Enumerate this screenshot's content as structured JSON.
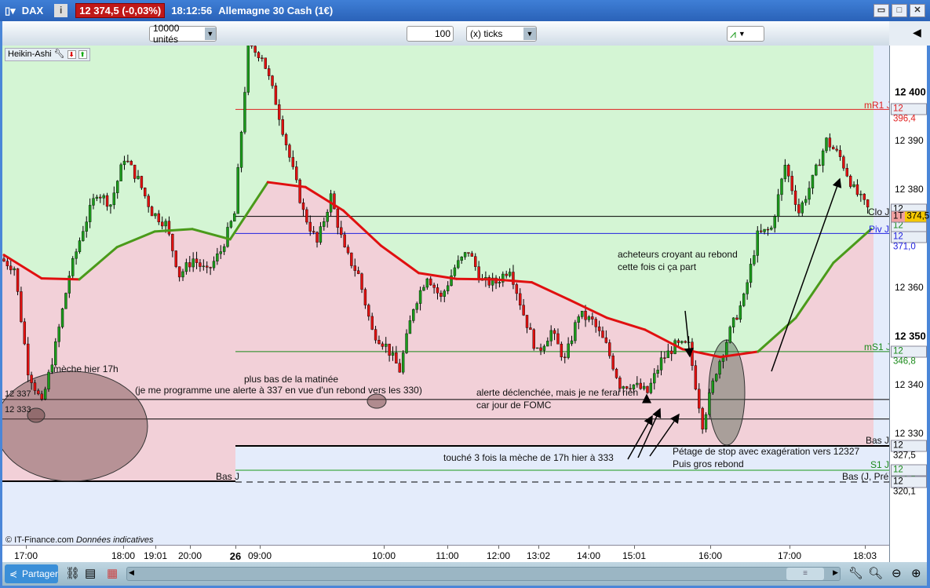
{
  "titlebar": {
    "chart_type_icon": "candlestick-icon",
    "symbol": "DAX",
    "info_label": "i",
    "price": "12 374,5 (-0,03%)",
    "time": "18:12:56",
    "description": "Allemagne 30 Cash (1€)",
    "price_bg": "#c01818"
  },
  "toolbar": {
    "units": "10000 unités",
    "ticks_value": "100",
    "ticks_unit": "(x) ticks"
  },
  "indicator": {
    "name": "Heikin-Ashi"
  },
  "footer": {
    "copyright": "© IT-Finance.com",
    "notice": "Données indicatives",
    "share_label": "Partager"
  },
  "xaxis": {
    "ticks": [
      "17:00",
      "18:00",
      "19:01",
      "20:00",
      "26",
      "09:00",
      "10:00",
      "11:00",
      "12:00",
      "13:02",
      "14:00",
      "15:01",
      "16:00",
      "17:00",
      "18:03"
    ]
  },
  "yaxis": {
    "ticks": [
      "12 400",
      "12 390",
      "12 380",
      "12 360",
      "12 350",
      "12 340",
      "12 330"
    ],
    "boxes": {
      "mr1": "12 396,4",
      "last_high": "12 375,6",
      "tick_label": "1T",
      "current": "374,5",
      "s_piv": "12 371,8",
      "piv": "12 371,0",
      "ms1": "12 346,8",
      "bas": "12 327,5",
      "s1": "12 322,5",
      "bas_pre": "12 320,1"
    }
  },
  "levels": {
    "mr1": "mR1 J",
    "clo": "Clo J",
    "piv": "Piv J",
    "ms1": "mS1 J",
    "bas": "Bas J",
    "s1": "S1 J",
    "bas_pre": "Bas (J, Pré)",
    "bas_left": "Bas J",
    "l337": "12 337",
    "l333": "12 333"
  },
  "annotations": {
    "meche": "mèche hier 17h",
    "plus_bas_1": "plus bas de la matinée",
    "plus_bas_2": "(je me programme une alerte à 337 en vue d'un rebond vers les 330)",
    "alerte_1": "alerte déclenchée, mais je ne ferai rien",
    "alerte_2": "car jour de FOMC",
    "touche": "touché 3 fois la mèche de 17h hier à 333",
    "acheteurs_1": "acheteurs croyant au rebond",
    "acheteurs_2": "cette fois ci ça part",
    "petage_1": "Pétage de stop avec exagération vers 12327",
    "petage_2": "Puis gros rebond"
  },
  "colors": {
    "bull": "#1a9a1a",
    "bear": "#e01010",
    "zone_up": "#d4f5d4",
    "zone_down": "#f2d0d8",
    "zone_below": "#e4ecfb",
    "ma_up": "#4a9a1a",
    "ma_down": "#e01010"
  },
  "chart_data": {
    "type": "candlestick",
    "ylim": [
      12309,
      12409
    ],
    "closes": [
      12365.8,
      12364,
      12343,
      12336,
      12348,
      12362.5,
      12372,
      12379.5,
      12377,
      12386.6,
      12382,
      12375.4,
      12373,
      12362.5,
      12365.8,
      12363,
      12367.4,
      12375,
      12409,
      12407.5,
      12398,
      12386.6,
      12375.4,
      12369,
      12378.6,
      12367.4,
      12362.5,
      12351,
      12348,
      12343,
      12356,
      12362.5,
      12357.7,
      12364,
      12367.4,
      12361,
      12361,
      12364,
      12354.5,
      12346.5,
      12351,
      12345,
      12354.5,
      12353,
      12348,
      12340,
      12340,
      12338.4,
      12345,
      12348,
      12348,
      12332,
      12343,
      12351,
      12357.7,
      12370.6,
      12372,
      12385,
      12375.4,
      12382,
      12390,
      12386.6,
      12380,
      12376
    ],
    "moving_average": [
      12366.6,
      12361.8,
      12361.6,
      12368.2,
      12371.4,
      12371.9,
      12369.8,
      12381.5,
      12380.5,
      12375.7,
      12368.5,
      12362.9,
      12361.7,
      12361.6,
      12361,
      12357.4,
      12353.7,
      12351.3,
      12347.3,
      12345.7,
      12346.8,
      12353.7,
      12365,
      12371.9
    ],
    "ma_trend": [
      "down",
      "down",
      "up",
      "up",
      "up",
      "up",
      "up",
      "down",
      "down",
      "down",
      "down",
      "down",
      "down",
      "down",
      "down",
      "down",
      "down",
      "down",
      "down",
      "down",
      "up",
      "up",
      "up",
      "up"
    ],
    "levels": [
      12396.4,
      12374.5,
      12371.0,
      12346.8,
      12337,
      12333,
      12327.5,
      12322.5,
      12320.1
    ]
  }
}
